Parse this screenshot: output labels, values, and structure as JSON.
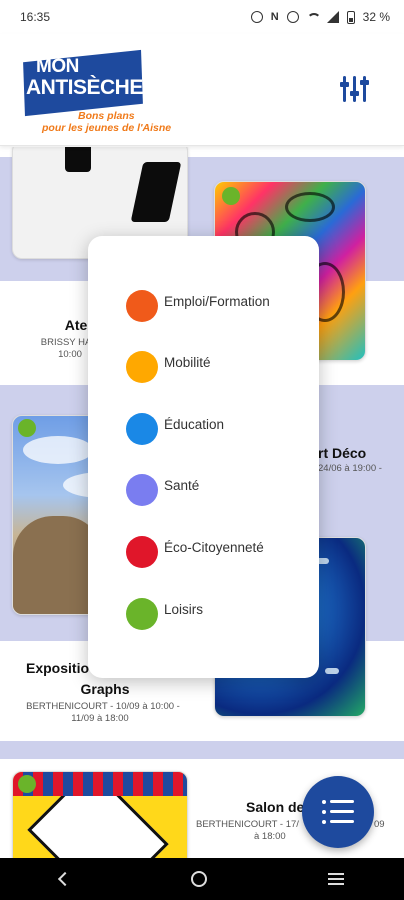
{
  "status_bar": {
    "time": "16:35",
    "battery": "32 %",
    "icons": [
      "alarm-icon",
      "nfc-icon",
      "mute-icon",
      "wifi-icon",
      "signal-icon",
      "battery-icon"
    ]
  },
  "header": {
    "logo_line1": "MON",
    "logo_line2": "ANTISÈCHE",
    "logo_tagline1": "Bons plans",
    "logo_tagline2": "pour les jeunes de l'Aisne",
    "filter_icon": "sliders-icon"
  },
  "cards": [
    {
      "title": "Atel",
      "meta1": "BRISSY HAM",
      "meta2": "10:00"
    },
    {
      "title": "rt Déco",
      "meta1": "24/06 à 19:00 -"
    },
    {
      "title": "Expositio",
      "title2": "Graphs",
      "meta1": "BERTHENICOURT - 10/09 à 10:00 -",
      "meta2": "11/09 à 18:00"
    },
    {
      "title": "Salon de",
      "meta1": "BERTHENICOURT - 17/",
      "meta1b": "09",
      "meta2": "à 18:00"
    }
  ],
  "popup": {
    "items": [
      {
        "label": "Emploi/Formation",
        "color": "#f05a1a"
      },
      {
        "label": "Mobilité",
        "color": "#ffa800"
      },
      {
        "label": "Éducation",
        "color": "#1a88e6"
      },
      {
        "label": "Santé",
        "color": "#7a7df0"
      },
      {
        "label": "Éco-Citoyenneté",
        "color": "#e0162a"
      },
      {
        "label": "Loisirs",
        "color": "#6ab42a"
      }
    ]
  },
  "colors": {
    "brand_blue": "#1e4a9e",
    "brand_orange": "#f07a1a",
    "lavender": "#cdd0ec",
    "loisirs_green": "#6ab42a"
  },
  "fab": {
    "icon": "list-icon"
  },
  "nav": {
    "icons": [
      "back-icon",
      "home-icon",
      "recent-apps-icon"
    ]
  }
}
